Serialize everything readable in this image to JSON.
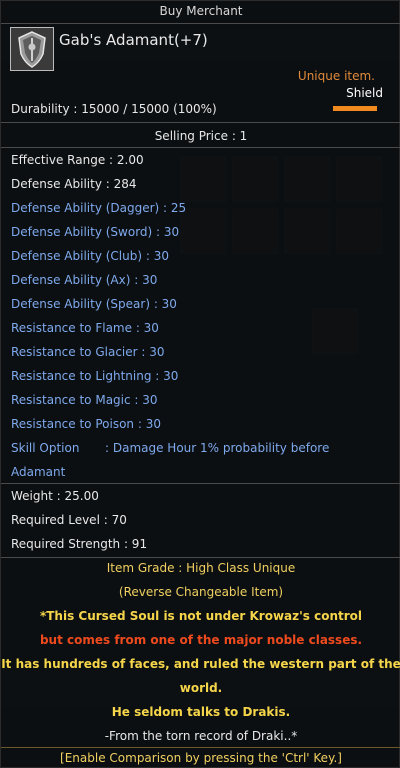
{
  "window": {
    "title": "Buy Merchant"
  },
  "item": {
    "name": "Gab's Adamant(+7)",
    "icon": "shield-icon",
    "rarity_label": "Unique item.",
    "type": "Shield",
    "type_bar_color": "#f08a1e",
    "durability": "Durability : 15000 / 15000 (100%)",
    "selling_price": "Selling Price : 1"
  },
  "stats": [
    {
      "text": "Effective Range : 2.00",
      "style": "white"
    },
    {
      "text": "Defense Ability : 284",
      "style": "white"
    },
    {
      "text": "Defense Ability (Dagger) : 25",
      "style": "blue"
    },
    {
      "text": "Defense Ability (Sword) : 30",
      "style": "blue"
    },
    {
      "text": "Defense Ability (Club) : 30",
      "style": "blue"
    },
    {
      "text": "Defense Ability (Ax) : 30",
      "style": "blue"
    },
    {
      "text": "Defense Ability (Spear) : 30",
      "style": "blue"
    },
    {
      "text": "Resistance to Flame : 30",
      "style": "blue"
    },
    {
      "text": "Resistance to Glacier : 30",
      "style": "blue"
    },
    {
      "text": "Resistance to Lightning : 30",
      "style": "blue"
    },
    {
      "text": "Resistance to Magic : 30",
      "style": "blue"
    },
    {
      "text": "Resistance to Poison : 30",
      "style": "blue"
    }
  ],
  "skill": {
    "label": "Skill Option",
    "text": ": Damage Hour 1% probability before",
    "text2": "Adamant"
  },
  "requirements": [
    {
      "text": "Weight : 25.00"
    },
    {
      "text": "Required Level : 70"
    },
    {
      "text": "Required Strength : 91"
    }
  ],
  "grade": {
    "text": "Item Grade : High Class Unique",
    "sub": "(Reverse Changeable Item)"
  },
  "lore": [
    {
      "text": "*This Cursed Soul is not under Krowaz's control",
      "style": "yellow"
    },
    {
      "text": "but comes from one of the major noble classes.",
      "style": "orange"
    },
    {
      "text": "It has hundreds of faces, and ruled the western part of the",
      "style": "yellow"
    },
    {
      "text": "world.",
      "style": "yellow"
    },
    {
      "text": "He seldom talks to Drakis.",
      "style": "yellow"
    },
    {
      "text": "-From the torn record of Draki..*",
      "style": "white"
    }
  ],
  "footer": "[Enable Comparison by pressing the 'Ctrl' Key.]",
  "colors": {
    "blue_text": "#7ea9ec",
    "white_text": "#e8e8e8",
    "yellow_text": "#f5d54a",
    "orange_text": "#ee4a1e",
    "rarity": "#e08a3a"
  }
}
